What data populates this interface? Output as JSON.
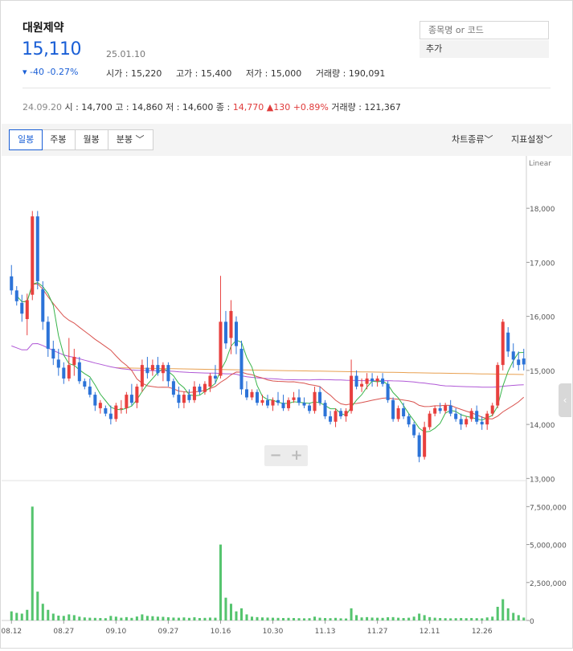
{
  "stock": {
    "name": "대원제약",
    "price": "15,110",
    "date": "25.01.10",
    "change": "▾ -40 -0.27%",
    "open": "시가 : 15,220",
    "high": "고가 : 15,400",
    "low": "저가 : 15,000",
    "volume": "거래량 : 190,091"
  },
  "search": {
    "placeholder": "종목명 or 코드",
    "add_label": "추가"
  },
  "prev_day": {
    "date": "24.09.20",
    "open": "시 : 14,700",
    "high": "고 : 14,860",
    "low": "저 : 14,600",
    "close_label": "종 : ",
    "close": "14,770",
    "change": "▲130 +0.89%",
    "volume": "거래량 : 121,367"
  },
  "toolbar": {
    "tabs": [
      "일봉",
      "주봉",
      "월봉",
      "분봉 ﹀"
    ],
    "chart_type": "차트종류﹀",
    "indicator": "지표설정﹀"
  },
  "zoom": {
    "minus": "−",
    "plus": "+"
  },
  "colors": {
    "up": "#e8403e",
    "down": "#2c73d8",
    "ma5": "#38b44a",
    "ma20": "#d9534f",
    "ma60": "#b058d6",
    "ma120": "#e8a050",
    "volume": "#55c46e"
  },
  "chart_data": {
    "type": "candlestick",
    "scale_label": "Linear",
    "price_ticks": [
      "18,000",
      "17,000",
      "16,000",
      "15,000",
      "14,000",
      "13,000"
    ],
    "price_tick_values": [
      18000,
      17000,
      16000,
      15000,
      14000,
      13000
    ],
    "ylim": [
      13000,
      18500
    ],
    "volume_ticks": [
      "7,500,000",
      "5,000,000",
      "2,500,000",
      "0"
    ],
    "volume_tick_values": [
      7500000,
      5000000,
      2500000,
      0
    ],
    "volume_ylim": [
      0,
      9000000
    ],
    "x_labels": [
      "08.12",
      "08.27",
      "09.10",
      "09.27",
      "10.16",
      "10.30",
      "11.13",
      "11.27",
      "12.11",
      "12.26"
    ],
    "x_label_index": [
      0,
      10,
      20,
      30,
      40,
      50,
      60,
      70,
      80,
      90
    ],
    "candles": [
      [
        16740,
        16950,
        16400,
        16480,
        600000
      ],
      [
        16480,
        16560,
        16200,
        16280,
        500000
      ],
      [
        16250,
        16400,
        15900,
        16050,
        450000
      ],
      [
        15950,
        16420,
        15650,
        16300,
        700000
      ],
      [
        16400,
        17950,
        16300,
        17850,
        7500000
      ],
      [
        17850,
        17950,
        16500,
        16650,
        1900000
      ],
      [
        16500,
        16650,
        15750,
        15900,
        1100000
      ],
      [
        15900,
        16000,
        15250,
        15400,
        700000
      ],
      [
        15400,
        15550,
        15100,
        15220,
        450000
      ],
      [
        15200,
        15400,
        14900,
        15050,
        320000
      ],
      [
        15050,
        15150,
        14750,
        14850,
        300000
      ],
      [
        14850,
        15600,
        14800,
        15100,
        400000
      ],
      [
        15100,
        15400,
        14900,
        15250,
        350000
      ],
      [
        15150,
        15250,
        14750,
        14800,
        250000
      ],
      [
        14800,
        14850,
        14650,
        14700,
        200000
      ],
      [
        14700,
        14850,
        14500,
        14550,
        180000
      ],
      [
        14550,
        14600,
        14250,
        14350,
        170000
      ],
      [
        14300,
        14450,
        14200,
        14400,
        160000
      ],
      [
        14300,
        14350,
        14150,
        14200,
        150000
      ],
      [
        14200,
        14350,
        14000,
        14100,
        300000
      ],
      [
        14100,
        14400,
        14050,
        14350,
        250000
      ],
      [
        14300,
        14450,
        14200,
        14300,
        180000
      ],
      [
        14300,
        14600,
        14200,
        14550,
        220000
      ],
      [
        14550,
        14750,
        14350,
        14400,
        170000
      ],
      [
        14400,
        14750,
        14300,
        14700,
        260000
      ],
      [
        14700,
        15200,
        14600,
        15100,
        400000
      ],
      [
        15050,
        15250,
        14850,
        14950,
        300000
      ],
      [
        15000,
        15200,
        14900,
        15100,
        280000
      ],
      [
        15100,
        15250,
        14900,
        14950,
        250000
      ],
      [
        14950,
        15150,
        14800,
        15100,
        240000
      ],
      [
        15100,
        15150,
        14700,
        14800,
        210000
      ],
      [
        14800,
        14850,
        14500,
        14550,
        190000
      ],
      [
        14550,
        14700,
        14300,
        14400,
        180000
      ],
      [
        14400,
        14600,
        14300,
        14550,
        200000
      ],
      [
        14550,
        14650,
        14400,
        14450,
        170000
      ],
      [
        14450,
        14800,
        14400,
        14700,
        210000
      ],
      [
        14700,
        14750,
        14550,
        14600,
        160000
      ],
      [
        14600,
        14800,
        14550,
        14750,
        170000
      ],
      [
        14700,
        14950,
        14600,
        14900,
        190000
      ],
      [
        14900,
        15100,
        14750,
        14850,
        180000
      ],
      [
        14900,
        16750,
        14850,
        15900,
        5000000
      ],
      [
        15900,
        16100,
        15400,
        15500,
        1500000
      ],
      [
        15600,
        16300,
        15300,
        16100,
        1100000
      ],
      [
        15900,
        16000,
        15300,
        15450,
        600000
      ],
      [
        15400,
        15550,
        14550,
        14650,
        800000
      ],
      [
        14650,
        14800,
        14450,
        14500,
        400000
      ],
      [
        14500,
        14650,
        14450,
        14600,
        250000
      ],
      [
        14600,
        14650,
        14350,
        14400,
        220000
      ],
      [
        14400,
        14550,
        14350,
        14450,
        200000
      ],
      [
        14450,
        14550,
        14300,
        14350,
        190000
      ],
      [
        14350,
        14500,
        14250,
        14450,
        180000
      ],
      [
        14450,
        14600,
        14350,
        14400,
        170000
      ],
      [
        14400,
        14550,
        14250,
        14300,
        160000
      ],
      [
        14300,
        14500,
        14250,
        14450,
        170000
      ],
      [
        14450,
        14600,
        14400,
        14500,
        160000
      ],
      [
        14500,
        14650,
        14350,
        14400,
        150000
      ],
      [
        14400,
        14500,
        14300,
        14350,
        140000
      ],
      [
        14350,
        14400,
        14200,
        14250,
        150000
      ],
      [
        14250,
        14700,
        14200,
        14600,
        250000
      ],
      [
        14600,
        14700,
        14350,
        14400,
        180000
      ],
      [
        14400,
        14450,
        14100,
        14150,
        160000
      ],
      [
        14150,
        14250,
        14000,
        14050,
        150000
      ],
      [
        14050,
        14300,
        13950,
        14250,
        170000
      ],
      [
        14250,
        14300,
        14100,
        14150,
        140000
      ],
      [
        14150,
        14300,
        14050,
        14250,
        130000
      ],
      [
        14250,
        15200,
        14200,
        14900,
        800000
      ],
      [
        14900,
        15000,
        14650,
        14700,
        350000
      ],
      [
        14700,
        14850,
        14600,
        14750,
        200000
      ],
      [
        14750,
        14950,
        14650,
        14850,
        220000
      ],
      [
        14850,
        14950,
        14700,
        14800,
        190000
      ],
      [
        14800,
        14900,
        14700,
        14850,
        180000
      ],
      [
        14850,
        14950,
        14700,
        14750,
        170000
      ],
      [
        14750,
        14800,
        14400,
        14450,
        210000
      ],
      [
        14450,
        14500,
        14050,
        14100,
        220000
      ],
      [
        14100,
        14350,
        14050,
        14300,
        180000
      ],
      [
        14300,
        14400,
        14100,
        14150,
        160000
      ],
      [
        14150,
        14200,
        13950,
        14000,
        180000
      ],
      [
        14000,
        14050,
        13750,
        13800,
        250000
      ],
      [
        13800,
        13850,
        13300,
        13400,
        450000
      ],
      [
        13400,
        14050,
        13350,
        13950,
        350000
      ],
      [
        13950,
        14250,
        13900,
        14200,
        220000
      ],
      [
        14200,
        14350,
        14150,
        14300,
        180000
      ],
      [
        14300,
        14400,
        14200,
        14250,
        160000
      ],
      [
        14250,
        14400,
        14200,
        14350,
        150000
      ],
      [
        14350,
        14450,
        14150,
        14200,
        140000
      ],
      [
        14200,
        14300,
        14050,
        14100,
        150000
      ],
      [
        14100,
        14200,
        13900,
        14000,
        160000
      ],
      [
        14000,
        14150,
        13950,
        14100,
        150000
      ],
      [
        14100,
        14300,
        14050,
        14250,
        160000
      ],
      [
        14250,
        14350,
        14000,
        14050,
        150000
      ],
      [
        14050,
        14150,
        13900,
        14000,
        140000
      ],
      [
        14000,
        14250,
        13900,
        14200,
        200000
      ],
      [
        14200,
        14400,
        14150,
        14350,
        250000
      ],
      [
        14350,
        15150,
        14300,
        15100,
        900000
      ],
      [
        15100,
        15950,
        15000,
        15900,
        1400000
      ],
      [
        15700,
        15800,
        15250,
        15350,
        800000
      ],
      [
        15350,
        15500,
        15050,
        15200,
        500000
      ],
      [
        15200,
        15350,
        15000,
        15100,
        350000
      ],
      [
        15220,
        15400,
        15000,
        15110,
        190091
      ]
    ]
  }
}
